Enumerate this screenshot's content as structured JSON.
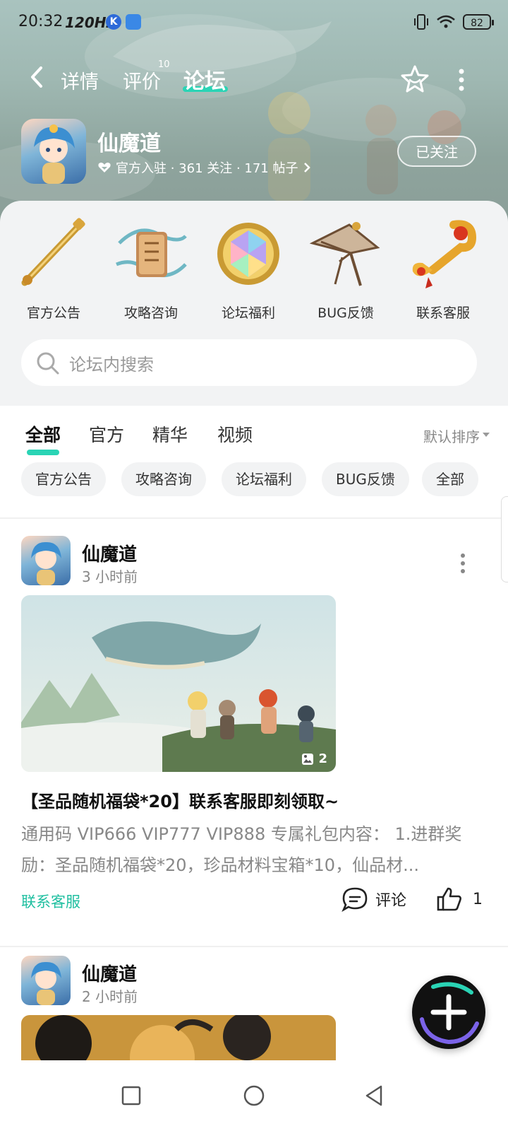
{
  "status_bar": {
    "time": "20:32",
    "refresh_rate": "120Hz",
    "k_badge": "K",
    "battery": "82"
  },
  "top_nav": {
    "tabs": [
      {
        "label": "详情"
      },
      {
        "label": "评价",
        "badge": "10"
      },
      {
        "label": "论坛"
      }
    ],
    "active_tab": "论坛"
  },
  "game": {
    "title": "仙魔道",
    "meta": "官方入驻 · 361 关注 · 171 帖子",
    "follow_label": "已关注"
  },
  "categories": [
    {
      "label": "官方公告",
      "icon": "golden-staff-icon"
    },
    {
      "label": "攻略咨询",
      "icon": "scroll-book-icon"
    },
    {
      "label": "论坛福利",
      "icon": "crystal-gem-icon"
    },
    {
      "label": "BUG反馈",
      "icon": "broken-umbrella-icon"
    },
    {
      "label": "联系客服",
      "icon": "ruyi-scepter-icon"
    }
  ],
  "search": {
    "placeholder": "论坛内搜索"
  },
  "feed": {
    "tabs": [
      "全部",
      "官方",
      "精华",
      "视频"
    ],
    "active_tab": "全部",
    "sort_label": "默认排序",
    "chips": [
      "官方公告",
      "攻略咨询",
      "论坛福利",
      "BUG反馈",
      "全部"
    ]
  },
  "posts": [
    {
      "author": "仙魔道",
      "time": "3 小时前",
      "image_count": "2",
      "title": "【圣品随机福袋*20】联系客服即刻领取~",
      "body": "通用码 VIP666 VIP777 VIP888 专属礼包内容： 1.进群奖励：圣品随机福袋*20，珍品材料宝箱*10，仙品材...",
      "tag": "联系客服",
      "comment_label": "评论",
      "like_count": "1"
    },
    {
      "author": "仙魔道",
      "time": "2 小时前"
    }
  ],
  "colors": {
    "accent": "#2ad4b5",
    "tag_green": "#1fbfa0",
    "hero_bg": "#9fb8b2"
  }
}
